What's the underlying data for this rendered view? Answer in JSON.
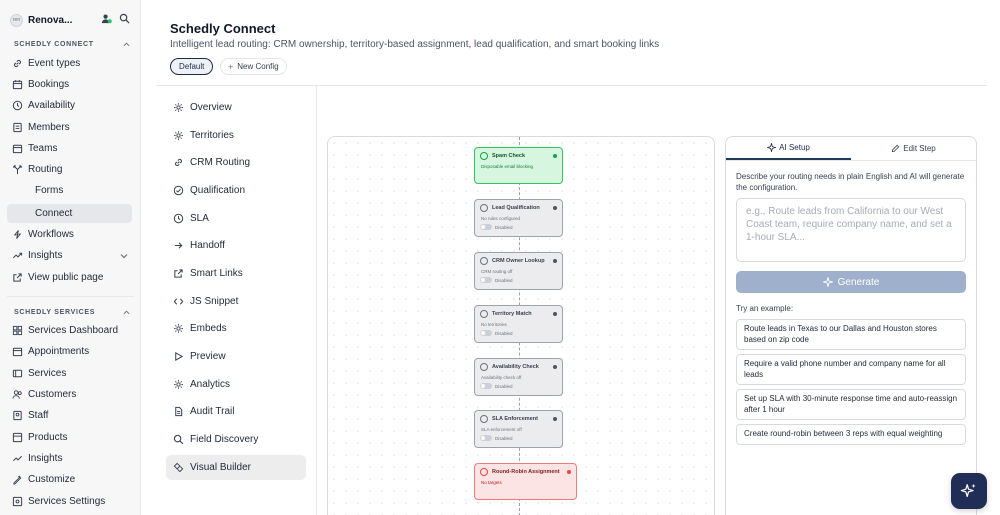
{
  "workspace": {
    "name": "Renova...",
    "avatar_text": "ren"
  },
  "sidebar": {
    "section1": "SCHEDLY CONNECT",
    "section2": "SCHEDLY SERVICES",
    "connect_items": [
      {
        "label": "Event types",
        "icon": "link-icon"
      },
      {
        "label": "Bookings",
        "icon": "calendar-icon"
      },
      {
        "label": "Availability",
        "icon": "clock-icon"
      },
      {
        "label": "Members",
        "icon": "members-icon"
      },
      {
        "label": "Teams",
        "icon": "teams-icon"
      },
      {
        "label": "Routing",
        "icon": "routing-icon"
      },
      {
        "label": "Forms",
        "icon": ""
      },
      {
        "label": "Connect",
        "icon": ""
      },
      {
        "label": "Workflows",
        "icon": "workflow-icon"
      },
      {
        "label": "Insights",
        "icon": "insights-icon"
      },
      {
        "label": "View public page",
        "icon": "external-link-icon"
      }
    ],
    "services_items": [
      {
        "label": "Services Dashboard",
        "icon": "grid-icon"
      },
      {
        "label": "Appointments",
        "icon": "calendar-icon"
      },
      {
        "label": "Services",
        "icon": "services-icon"
      },
      {
        "label": "Customers",
        "icon": "users-icon"
      },
      {
        "label": "Staff",
        "icon": "staff-icon"
      },
      {
        "label": "Products",
        "icon": "products-icon"
      },
      {
        "label": "Insights",
        "icon": "insights-icon"
      },
      {
        "label": "Customize",
        "icon": "customize-icon"
      },
      {
        "label": "Services Settings",
        "icon": "settings-icon"
      }
    ]
  },
  "header": {
    "title": "Schedly Connect",
    "subtitle": "Intelligent lead routing: CRM ownership, territory-based assignment, lead qualification, and smart booking links",
    "config_default": "Default",
    "new_config": "New Config"
  },
  "menu": [
    {
      "label": "Overview",
      "icon": "gear-icon"
    },
    {
      "label": "Territories",
      "icon": "gear-icon"
    },
    {
      "label": "CRM Routing",
      "icon": "link-icon"
    },
    {
      "label": "Qualification",
      "icon": "check-circle-icon"
    },
    {
      "label": "SLA",
      "icon": "clock-icon"
    },
    {
      "label": "Handoff",
      "icon": "arrow-right-icon"
    },
    {
      "label": "Smart Links",
      "icon": "external-link-icon"
    },
    {
      "label": "JS Snippet",
      "icon": "code-icon"
    },
    {
      "label": "Embeds",
      "icon": "gear-icon"
    },
    {
      "label": "Preview",
      "icon": "play-icon"
    },
    {
      "label": "Analytics",
      "icon": "gear-icon"
    },
    {
      "label": "Audit Trail",
      "icon": "document-icon"
    },
    {
      "label": "Field Discovery",
      "icon": "search-icon"
    },
    {
      "label": "Visual Builder",
      "icon": "flow-icon"
    }
  ],
  "flow": {
    "nodes": [
      {
        "title": "Spam Check",
        "subtitle": "Disposable email blocking",
        "status": "",
        "variant": "green"
      },
      {
        "title": "Lead Qualification",
        "subtitle": "No rules configured",
        "status": "Disabled",
        "variant": "gray"
      },
      {
        "title": "CRM Owner Lookup",
        "subtitle": "CRM routing off",
        "status": "Disabled",
        "variant": "gray"
      },
      {
        "title": "Territory Match",
        "subtitle": "No territories",
        "status": "Disabled",
        "variant": "gray"
      },
      {
        "title": "Availability Check",
        "subtitle": "Availability check off",
        "status": "Disabled",
        "variant": "gray"
      },
      {
        "title": "SLA Enforcement",
        "subtitle": "SLA enforcement off",
        "status": "Disabled",
        "variant": "gray"
      },
      {
        "title": "Round-Robin Assignment",
        "subtitle": "No targets",
        "status": "",
        "variant": "red"
      }
    ],
    "colors": {
      "green": "#34c45b",
      "red": "#f27c7c",
      "gray": "#9ca3af"
    }
  },
  "panel": {
    "tab_ai": "AI Setup",
    "tab_edit": "Edit Step",
    "description": "Describe your routing needs in plain English and AI will generate the configuration.",
    "placeholder": "e.g., Route leads from California to our West Coast team, require company name, and set a 1-hour SLA...",
    "generate": "Generate",
    "try_label": "Try an example:",
    "examples": [
      "Route leads in Texas to our Dallas and Houston stores based on zip code",
      "Require a valid phone number and company name for all leads",
      "Set up SLA with 30-minute response time and auto-reassign after 1 hour",
      "Create round-robin between 3 reps with equal weighting"
    ]
  },
  "colors": {
    "accent": "#1f2d57",
    "generate_bg": "#9fb0cc",
    "active_bg": "#e6e7ea"
  }
}
